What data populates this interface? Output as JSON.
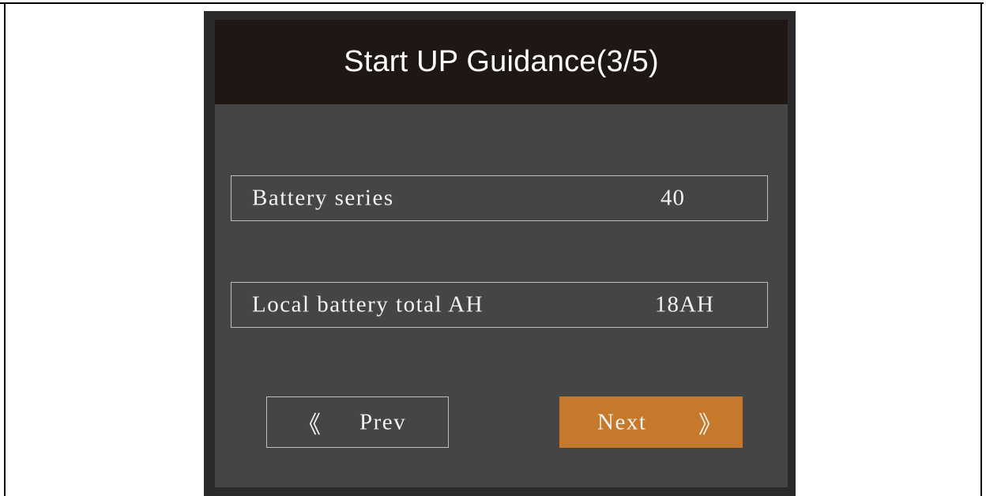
{
  "window": {
    "title": "Start UP Guidance(3/5)"
  },
  "fields": [
    {
      "label": "Battery series",
      "value": "40"
    },
    {
      "label": "Local battery total AH",
      "value": "18AH"
    }
  ],
  "buttons": {
    "prev": {
      "label": "Prev",
      "icon": "double-chevron-left-icon",
      "arrow_glyph": "《"
    },
    "next": {
      "label": "Next",
      "icon": "double-chevron-right-icon",
      "arrow_glyph": "》"
    }
  },
  "colors": {
    "title_bar": "#1e1714",
    "screen_bg": "#454545",
    "frame": "#2a2a2a",
    "next_button": "#c5792a",
    "text": "#f2f2f2",
    "border": "#bdbdbd"
  }
}
